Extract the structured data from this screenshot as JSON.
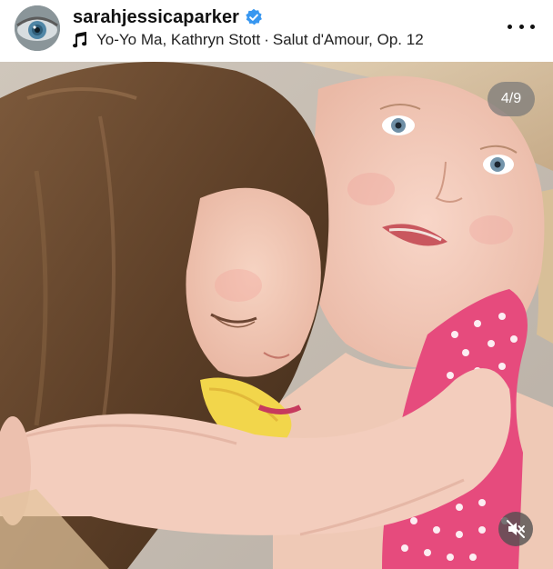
{
  "post": {
    "username": "sarahjessicaparker",
    "verified": true,
    "audio": {
      "artists": "Yo-Yo Ma, Kathryn Stott",
      "separator": "·",
      "track": "Salut d'Amour, Op. 12"
    },
    "carousel": {
      "current": "4",
      "total": "9",
      "label": "4/9"
    },
    "audio_state": "muted"
  },
  "icons": {
    "avatar": "eye-closeup-avatar",
    "verified": "verified-badge-icon",
    "music": "music-note-icon",
    "more": "more-options-icon",
    "mute": "speaker-muted-icon"
  },
  "colors": {
    "verified_blue": "#3897f0",
    "text_primary": "#111111",
    "overlay": "#787878"
  }
}
